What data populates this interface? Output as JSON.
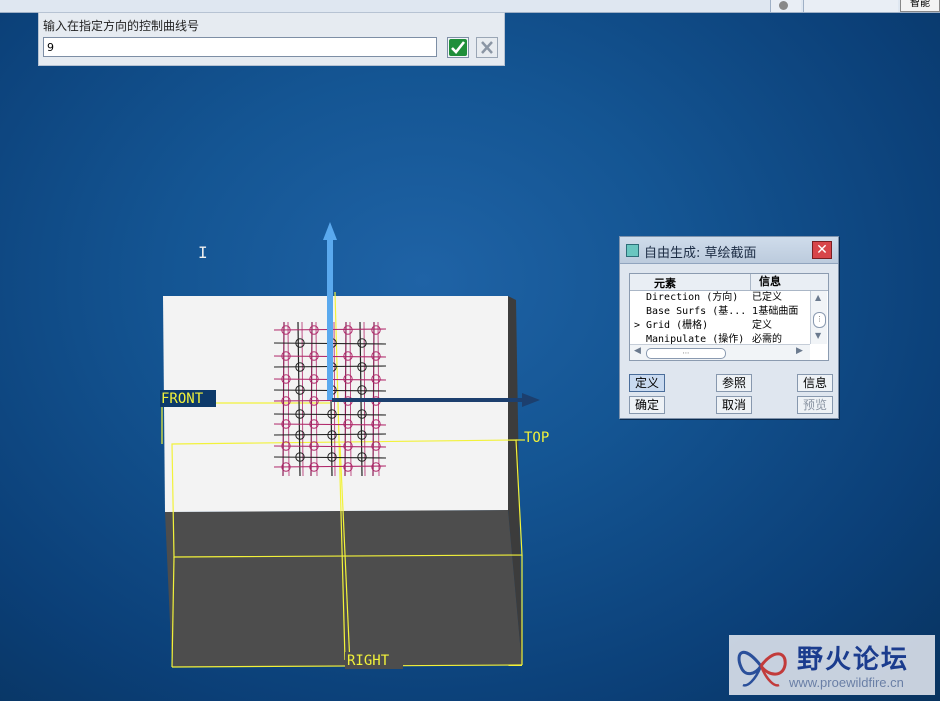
{
  "topbar": {
    "right_button": "智能"
  },
  "prompt": {
    "label": "输入在指定方向的控制曲线号",
    "value": "9",
    "ok_icon": "check-icon",
    "cancel_icon": "x-icon"
  },
  "viewport": {
    "datum_front": "FRONT",
    "datum_top": "TOP",
    "datum_right": "RIGHT"
  },
  "dialog": {
    "title": "自由生成: 草绘截面",
    "col_element": "元素",
    "col_info": "信息",
    "rows": [
      {
        "element": "Direction (方向)",
        "info": "已定义",
        "marker": ""
      },
      {
        "element": "Base Surfs (基...",
        "info": "1基础曲面",
        "marker": ""
      },
      {
        "element": "Grid (栅格)",
        "info": "定义",
        "marker": ">"
      },
      {
        "element": "Manipulate (操作)",
        "info": "必需的",
        "marker": ""
      }
    ],
    "buttons": {
      "define": "定义",
      "refs": "参照",
      "info": "信息",
      "ok": "确定",
      "cancel": "取消",
      "preview": "预览"
    }
  },
  "watermark": {
    "name": "野火论坛",
    "url": "www.proewildfire.cn"
  },
  "colors": {
    "background": "#145593",
    "grid_magenta": "#b0286a",
    "datum_yellow": "#f2f23a",
    "axis_blue": "#5aa9ee"
  }
}
